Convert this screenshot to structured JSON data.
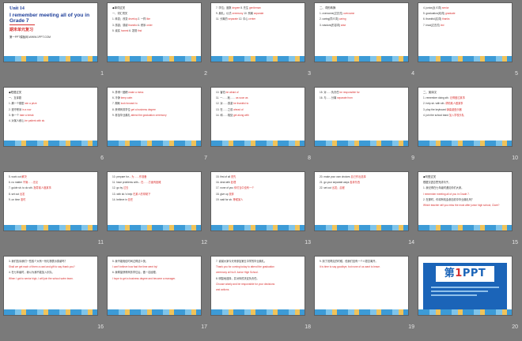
{
  "colors": {
    "background": "#7a7a7a",
    "slide": "#ffffff",
    "title_blue": "#1f3f9a",
    "highlight_red": "#d8302f",
    "band_blue": "#3d9bd6"
  },
  "slides": [
    {
      "num": "1",
      "type": "title",
      "unit": "Unit 14",
      "title": "I remember meeting all of you in Grade 7",
      "subtitle": "期末单元复习",
      "site": "第一PPT模板网-WWW.1PPT.COM"
    },
    {
      "num": "2",
      "lines": [
        [
          {
            "t": "◆单词过关"
          }
        ],
        [
          {
            "t": "一、词汇闯关"
          }
        ],
        [
          {
            "t": "1. 转变；改变 "
          },
          {
            "t": "develop",
            "r": true
          },
          {
            "t": "    2. 一样 "
          },
          {
            "t": "like",
            "r": true
          }
        ],
        [
          {
            "t": "3. 感激；感谢 "
          },
          {
            "t": "thankful",
            "r": true
          },
          {
            "t": "    4. 秩序 "
          },
          {
            "t": "order",
            "r": true
          }
        ],
        [
          {
            "t": "5. 诚实 "
          },
          {
            "t": "honest",
            "r": true
          },
          {
            "t": "    6. 发现 "
          },
          {
            "t": "find",
            "r": true
          }
        ]
      ]
    },
    {
      "num": "3",
      "lines": [
        [
          {
            "t": "7. 学位；度数 "
          },
          {
            "t": "degree",
            "r": true
          },
          {
            "t": "  8. 先生 "
          },
          {
            "t": "gentleman",
            "r": true
          }
        ],
        [
          {
            "t": "9. 典礼；仪式 "
          },
          {
            "t": "ceremony",
            "r": true
          },
          {
            "t": "  10. 别离 "
          },
          {
            "t": "separate",
            "r": true
          }
        ],
        [
          {
            "t": "11. 分离的 "
          },
          {
            "t": "separate",
            "r": true
          },
          {
            "t": "  12. 中心 "
          },
          {
            "t": "center",
            "r": true
          }
        ]
      ]
    },
    {
      "num": "4",
      "lines": [
        [
          {
            "t": "二、词形转换"
          }
        ],
        [
          {
            "t": "1. overcome(过去式) "
          },
          {
            "t": "overcame",
            "r": true
          }
        ],
        [
          {
            "t": "2. caring(同义词) "
          },
          {
            "t": "caring",
            "r": true
          }
        ],
        [
          {
            "t": "3. wisdom(形容词) "
          },
          {
            "t": "wise",
            "r": true
          }
        ]
      ]
    },
    {
      "num": "5",
      "lines": [
        [
          {
            "t": "4. junior(反义词) "
          },
          {
            "t": "senior",
            "r": true
          }
        ],
        [
          {
            "t": "5. graduation(动词) "
          },
          {
            "t": "graduate",
            "r": true
          }
        ],
        [
          {
            "t": "6. thankful(名词) "
          },
          {
            "t": "thanks",
            "r": true
          }
        ],
        [
          {
            "t": "7. lead(过去式) "
          },
          {
            "t": "led",
            "r": true
          }
        ]
      ]
    },
    {
      "num": "6",
      "lines": [
        [
          {
            "t": "◆短语过关"
          }
        ],
        [
          {
            "t": "一、互译题"
          }
        ],
        [
          {
            "t": "1. 摘一个模型 "
          },
          {
            "t": "win a prize",
            "r": true
          }
        ],
        [
          {
            "t": "2. 遵守秩序 "
          },
          {
            "t": "in a row",
            "r": true
          }
        ],
        [
          {
            "t": "3. 休一个 "
          },
          {
            "t": "take a break",
            "r": true
          }
        ],
        [
          {
            "t": "4. 对某人耐心 "
          },
          {
            "t": "be patient with sb.",
            "r": true
          }
        ]
      ]
    },
    {
      "num": "7",
      "lines": [
        [
          {
            "t": "5. 弄得一团糟 "
          },
          {
            "t": "make a mess",
            "r": true
          }
        ],
        [
          {
            "t": "6. 冷静 "
          },
          {
            "t": "keep calm",
            "r": true
          }
        ],
        [
          {
            "t": "7. 期盼 "
          },
          {
            "t": "look forward to",
            "r": true
          }
        ],
        [
          {
            "t": "8. 获得商务学位 "
          },
          {
            "t": "get a business degree",
            "r": true
          }
        ],
        [
          {
            "t": "9. 参加毕业典礼 "
          },
          {
            "t": "attend the graduation ceremony",
            "r": true
          }
        ]
      ]
    },
    {
      "num": "8",
      "lines": [
        [
          {
            "t": "10. 害怕 "
          },
          {
            "t": "be afraid of",
            "r": true
          }
        ],
        [
          {
            "t": "11. 一……就…… "
          },
          {
            "t": "as soon as",
            "r": true
          }
        ],
        [
          {
            "t": "12. 对……感激 "
          },
          {
            "t": "be thankful to",
            "r": true
          }
        ],
        [
          {
            "t": "13. 在……之前 "
          },
          {
            "t": "ahead of",
            "r": true
          }
        ],
        [
          {
            "t": "14. 和……相处 "
          },
          {
            "t": "get along with",
            "r": true
          }
        ]
      ]
    },
    {
      "num": "9",
      "lines": [
        [
          {
            "t": "15. 对……负责任 "
          },
          {
            "t": "be responsible for",
            "r": true
          }
        ],
        [
          {
            "t": "16. 与……分离 "
          },
          {
            "t": "separate from",
            "r": true
          }
        ]
      ]
    },
    {
      "num": "10",
      "lines": [
        [
          {
            "t": "二、英译汉"
          }
        ],
        [
          {
            "t": "1. remember doing sth. "
          },
          {
            "t": "记得做过某事",
            "r": true
          }
        ],
        [
          {
            "t": "2. help sb. with sth. "
          },
          {
            "t": "帮助某人做某事",
            "r": true
          }
        ],
        [
          {
            "t": "3. play the keyboard "
          },
          {
            "t": "弹奏键盘乐器",
            "r": true
          }
        ],
        [
          {
            "t": "4. join the school band "
          },
          {
            "t": "加入学校乐队",
            "r": true
          }
        ]
      ]
    },
    {
      "num": "11",
      "lines": [
        [
          {
            "t": "5. work out "
          },
          {
            "t": "解决",
            "r": true
          }
        ],
        [
          {
            "t": "6. no matter "
          },
          {
            "t": "不管……无论",
            "r": true
          }
        ],
        [
          {
            "t": "7. guide sb. to do sth. "
          },
          {
            "t": "指导某人做某事",
            "r": true
          }
        ],
        [
          {
            "t": "8. set out "
          },
          {
            "t": "出发",
            "r": true
          }
        ],
        [
          {
            "t": "9. on time "
          },
          {
            "t": "准时",
            "r": true
          }
        ]
      ]
    },
    {
      "num": "12",
      "lines": [
        [
          {
            "t": "10. prepare for... "
          },
          {
            "t": "为……作准备",
            "r": true
          }
        ],
        [
          {
            "t": "11. have problems with... "
          },
          {
            "t": "在……方面有困难",
            "r": true
          }
        ],
        [
          {
            "t": "12. go by "
          },
          {
            "t": "过去",
            "r": true
          }
        ],
        [
          {
            "t": "13. with sb.'s help "
          },
          {
            "t": "在某人的帮助下",
            "r": true
          }
        ],
        [
          {
            "t": "14. believe in "
          },
          {
            "t": "信任",
            "r": true
          }
        ]
      ]
    },
    {
      "num": "13",
      "lines": [
        [
          {
            "t": "15. first of all "
          },
          {
            "t": "首先",
            "r": true
          }
        ],
        [
          {
            "t": "16. deal with "
          },
          {
            "t": "处理",
            "r": true
          }
        ],
        [
          {
            "t": "17. none of you "
          },
          {
            "t": "你们当中没有一个",
            "r": true
          }
        ],
        [
          {
            "t": "18. give up "
          },
          {
            "t": "放弃",
            "r": true
          }
        ],
        [
          {
            "t": "19. wait for sb. "
          },
          {
            "t": "等候某人",
            "r": true
          }
        ]
      ]
    },
    {
      "num": "14",
      "lines": [
        [
          {
            "t": "20. make your own choices "
          },
          {
            "t": "自己作出选择",
            "r": true
          }
        ],
        [
          {
            "t": "21. go your separate ways "
          },
          {
            "t": "各奔东西",
            "r": true
          }
        ],
        [
          {
            "t": "22. set out "
          },
          {
            "t": "出发；启程",
            "r": true
          }
        ]
      ]
    },
    {
      "num": "15",
      "lines": [
        [
          {
            "t": "◆句型过关"
          }
        ],
        [
          {
            "t": "根据汉语意思完成句子。"
          }
        ],
        [
          {
            "t": "1. 我记得在七年级时遇见你们大家。"
          }
        ],
        [
          {
            "t": "I remember meeting all of you in Grade 7.",
            "r": true
          }
        ],
        [
          {
            "t": "2. 在那时，你将有机会参加初中毕业典礼吗？"
          }
        ],
        [
          {
            "t": "Which teacher will you miss the most after junior high school, Clare?",
            "r": true
          }
        ]
      ]
    },
    {
      "num": "16",
      "lines": [
        [
          {
            "t": "3. 我们告诉我们一些各个大有一份礼物表示感谢吗？"
          }
        ],
        [
          {
            "t": "Shall we get each of them a card and gift to say thank you?",
            "r": true
          }
        ],
        [
          {
            "t": "4. 在七年级时，我以为我不能加入乐队。"
          }
        ],
        [
          {
            "t": "When I got to senior high, I will join the school swim team.",
            "r": true
          }
        ]
      ]
    },
    {
      "num": "17",
      "lines": [
        [
          {
            "t": "5. 我不能相信时间过得这么快。"
          }
        ],
        [
          {
            "t": "I can't believe how fast the time went by!",
            "r": true
          }
        ],
        [
          {
            "t": "6. 我希望获得商务学位后，做一名经理。"
          }
        ],
        [
          {
            "t": "I hope to get a business degree and become a manager.",
            "r": true
          }
        ]
      ]
    },
    {
      "num": "18",
      "lines": [
        [
          {
            "t": "7. 谢谢大家今天来参加第五中学的毕业典礼。"
          }
        ],
        [
          {
            "t": "Thank you for coming today to attend the graduation",
            "r": true
          }
        ],
        [
          {
            "t": "ceremony at No.5 Junior High School.",
            "r": true
          }
        ],
        [
          {
            "t": "8. 明智地选择，并对你的决定负责任。"
          }
        ],
        [
          {
            "t": "Choose wisely and be responsible for your decisions",
            "r": true
          }
        ],
        [
          {
            "t": "and actions.",
            "r": true
          }
        ]
      ]
    },
    {
      "num": "19",
      "lines": [
        [
          {
            "t": "9. 到了说再见的时候，但我们没有一个人愿意离开。"
          }
        ],
        [
          {
            "t": "It is time to say goodbye, but none of us want to leave.",
            "r": true
          }
        ]
      ]
    },
    {
      "num": "20",
      "type": "logo",
      "logo_prefix": "第",
      "logo_one": "1",
      "logo_suffix": "PPT"
    }
  ]
}
